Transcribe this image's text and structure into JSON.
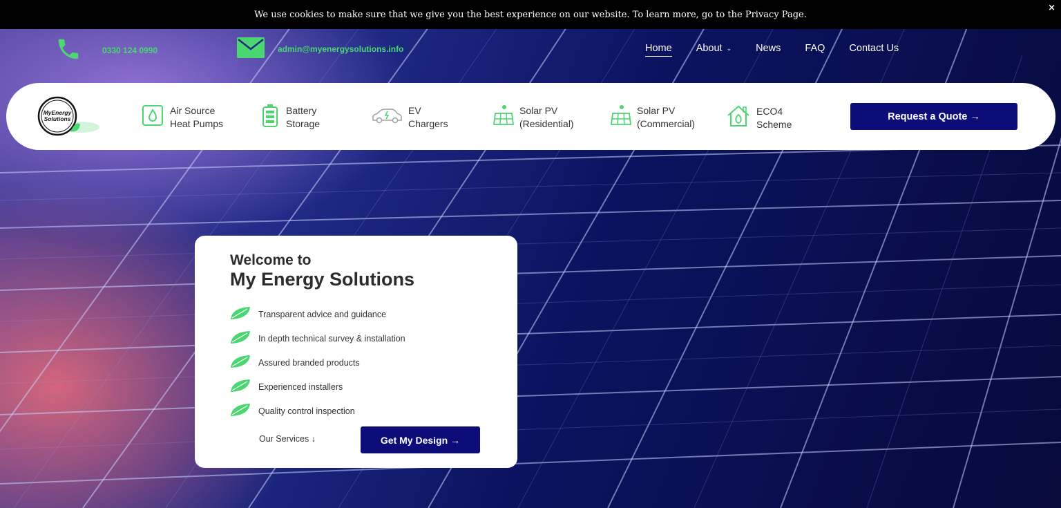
{
  "cookie_bar": {
    "message": "We use cookies to make sure that we give you the best experience on our website. To learn more, go to the Privacy Page.",
    "close_label": "×"
  },
  "contact": {
    "phone": "0330 124 0990",
    "email": "admin@myenergysolutions.info"
  },
  "nav": {
    "items": [
      {
        "label": "Home",
        "active": true
      },
      {
        "label": "About",
        "has_dropdown": true
      },
      {
        "label": "News"
      },
      {
        "label": "FAQ"
      },
      {
        "label": "Contact Us"
      }
    ]
  },
  "services": {
    "logo_text": [
      "MyEnergy",
      "Solutions"
    ],
    "items": [
      {
        "line1": "Air Source",
        "line2": "Heat Pumps",
        "icon": "heat-pump-icon"
      },
      {
        "line1": "Battery",
        "line2": "Storage",
        "icon": "battery-icon"
      },
      {
        "line1": "EV",
        "line2": "Chargers",
        "icon": "ev-car-icon"
      },
      {
        "line1": "Solar PV",
        "line2": "(Residential)",
        "icon": "solar-panel-icon"
      },
      {
        "line1": "Solar PV",
        "line2": "(Commercial)",
        "icon": "solar-panel-icon"
      },
      {
        "line1": "ECO4",
        "line2": "Scheme",
        "icon": "eco-house-icon"
      }
    ],
    "quote_button": "Request a Quote →"
  },
  "welcome": {
    "subtitle": "Welcome to",
    "title": "My Energy Solutions",
    "features": [
      "Transparent advice and guidance",
      "In depth technical survey & installation",
      "Assured branded products",
      "Experienced installers",
      "Quality control inspection"
    ],
    "services_link": "Our Services ↓",
    "design_button": "Get My Design →"
  },
  "colors": {
    "accent_green": "#4bd672",
    "button_navy": "#0d0d7a",
    "cookie_bg": "#000000"
  }
}
